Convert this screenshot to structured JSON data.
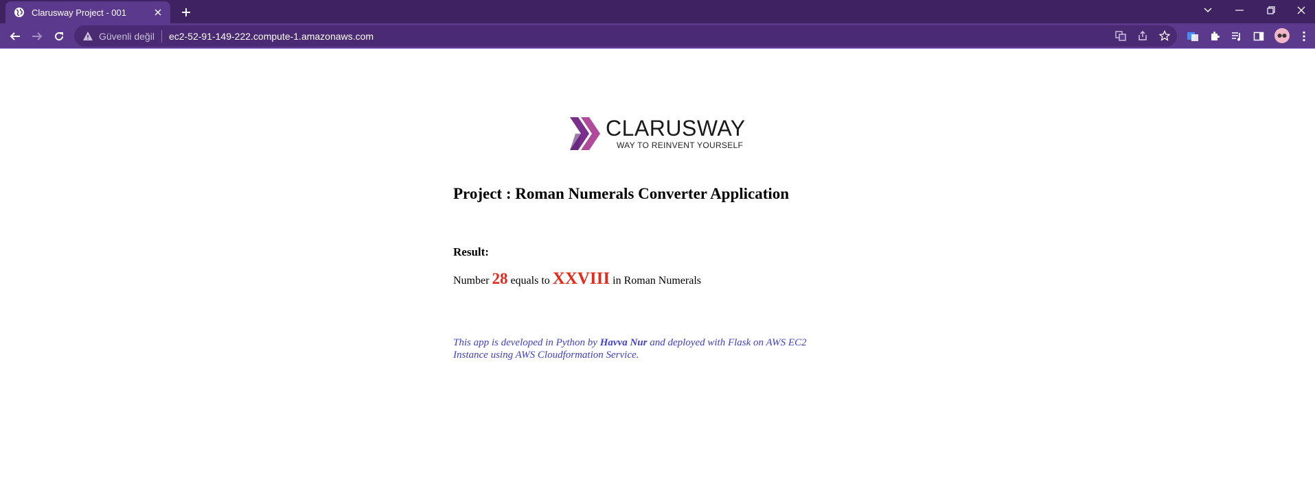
{
  "browser": {
    "tab": {
      "title": "Clarusway Project - 001"
    },
    "security_label": "Güvenli değil",
    "url": "ec2-52-91-149-222.compute-1.amazonaws.com",
    "theme_color": "#5b3a8e"
  },
  "page": {
    "logo": {
      "wordmark": "CLARUSWAY",
      "tagline": "WAY TO REINVENT YOURSELF"
    },
    "heading": "Project : Roman Numerals Converter Application",
    "result_label": "Result:",
    "result": {
      "prefix": "Number",
      "number": "28",
      "middle": "equals to",
      "roman": "XXVIII",
      "suffix": "in Roman Numerals",
      "highlight_color": "#e8281a"
    },
    "footer": {
      "part1": "This app is developed in Python by",
      "author": "Havva Nur",
      "part2": "and deployed with Flask on AWS EC2 Instance using AWS Cloudformation Service."
    }
  }
}
